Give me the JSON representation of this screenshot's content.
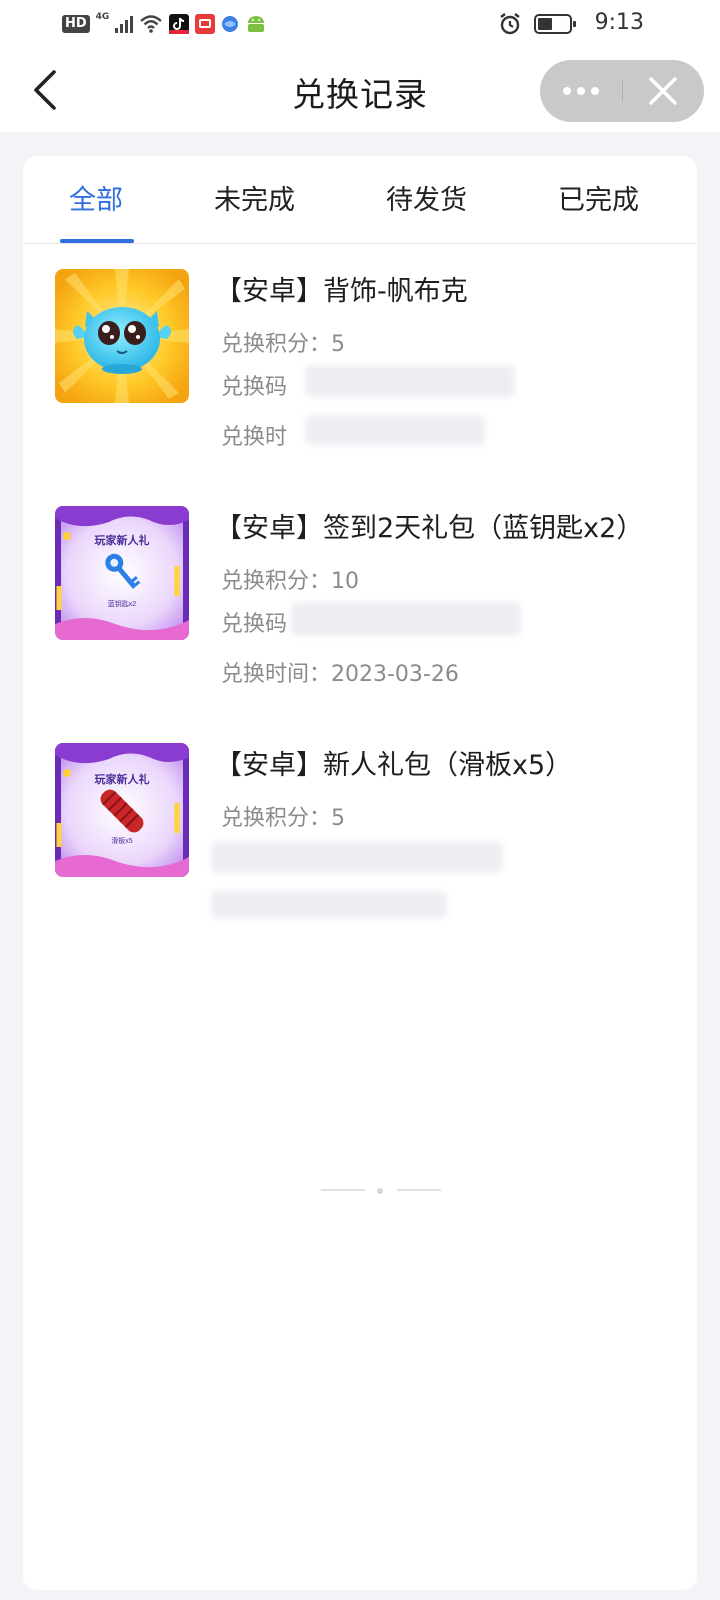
{
  "status_bar": {
    "hd": "HD",
    "network": "4G",
    "time": "9:13"
  },
  "nav": {
    "title": "兑换记录"
  },
  "tabs": [
    {
      "label": "全部"
    },
    {
      "label": "未完成"
    },
    {
      "label": "待发货"
    },
    {
      "label": "已完成"
    }
  ],
  "items": [
    {
      "title": "【安卓】背饰-帆布克",
      "points": "兑换积分：5",
      "code_label": "兑换码",
      "time_label": "兑换时"
    },
    {
      "title": "【安卓】签到2天礼包（蓝钥匙x2）",
      "points": "兑换积分：10",
      "code_label": "兑换码",
      "time": "兑换时间：2023-03-26",
      "thumb_title": "玩家新人礼",
      "thumb_caption": "蓝钥匙x2"
    },
    {
      "title": "【安卓】新人礼包（滑板x5）",
      "points": "兑换积分：5",
      "thumb_title": "玩家新人礼",
      "thumb_caption": "滑板x5"
    }
  ],
  "colors": {
    "accent": "#2f6fe0",
    "page_bg": "#f3f4f7"
  }
}
